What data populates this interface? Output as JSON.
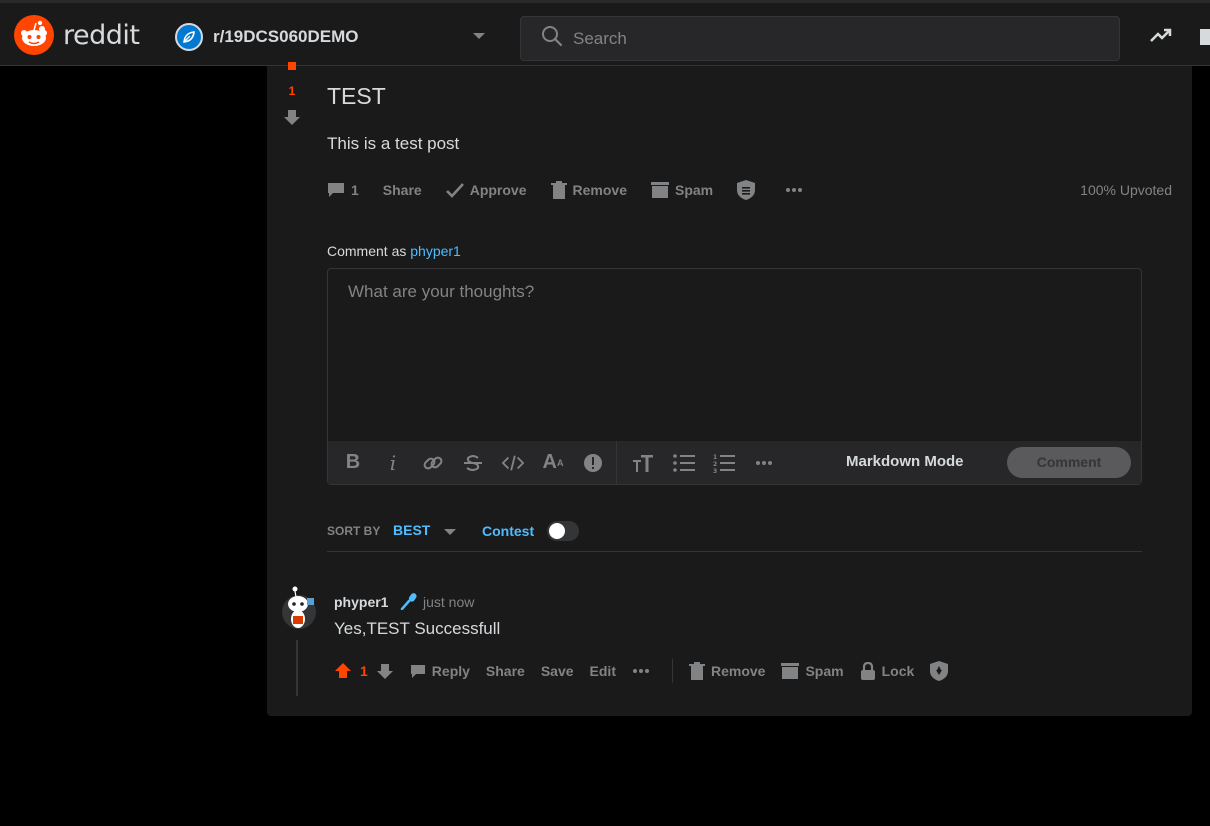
{
  "header": {
    "logo_text": "reddit",
    "community": "r/19DCS060DEMO",
    "search_placeholder": "Search"
  },
  "post": {
    "score": "1",
    "title": "TEST",
    "body": "This is a test post",
    "actions": {
      "comments_count": "1",
      "share": "Share",
      "approve": "Approve",
      "remove": "Remove",
      "spam": "Spam"
    },
    "upvoted": "100% Upvoted"
  },
  "composer": {
    "comment_as_label": "Comment as",
    "username": "phyper1",
    "placeholder": "What are your thoughts?",
    "markdown_mode": "Markdown Mode",
    "comment_button": "Comment"
  },
  "sort": {
    "label": "SORT BY",
    "value": "BEST",
    "contest": "Contest"
  },
  "comment": {
    "author": "phyper1",
    "time": "just now",
    "text": "Yes,TEST Successfull",
    "score": "1",
    "reply": "Reply",
    "share": "Share",
    "save": "Save",
    "edit": "Edit",
    "remove": "Remove",
    "spam": "Spam",
    "lock": "Lock"
  },
  "colors": {
    "accent": "#ff4500",
    "link": "#4fbcff",
    "card": "#1a1a1b",
    "muted": "#818384"
  }
}
